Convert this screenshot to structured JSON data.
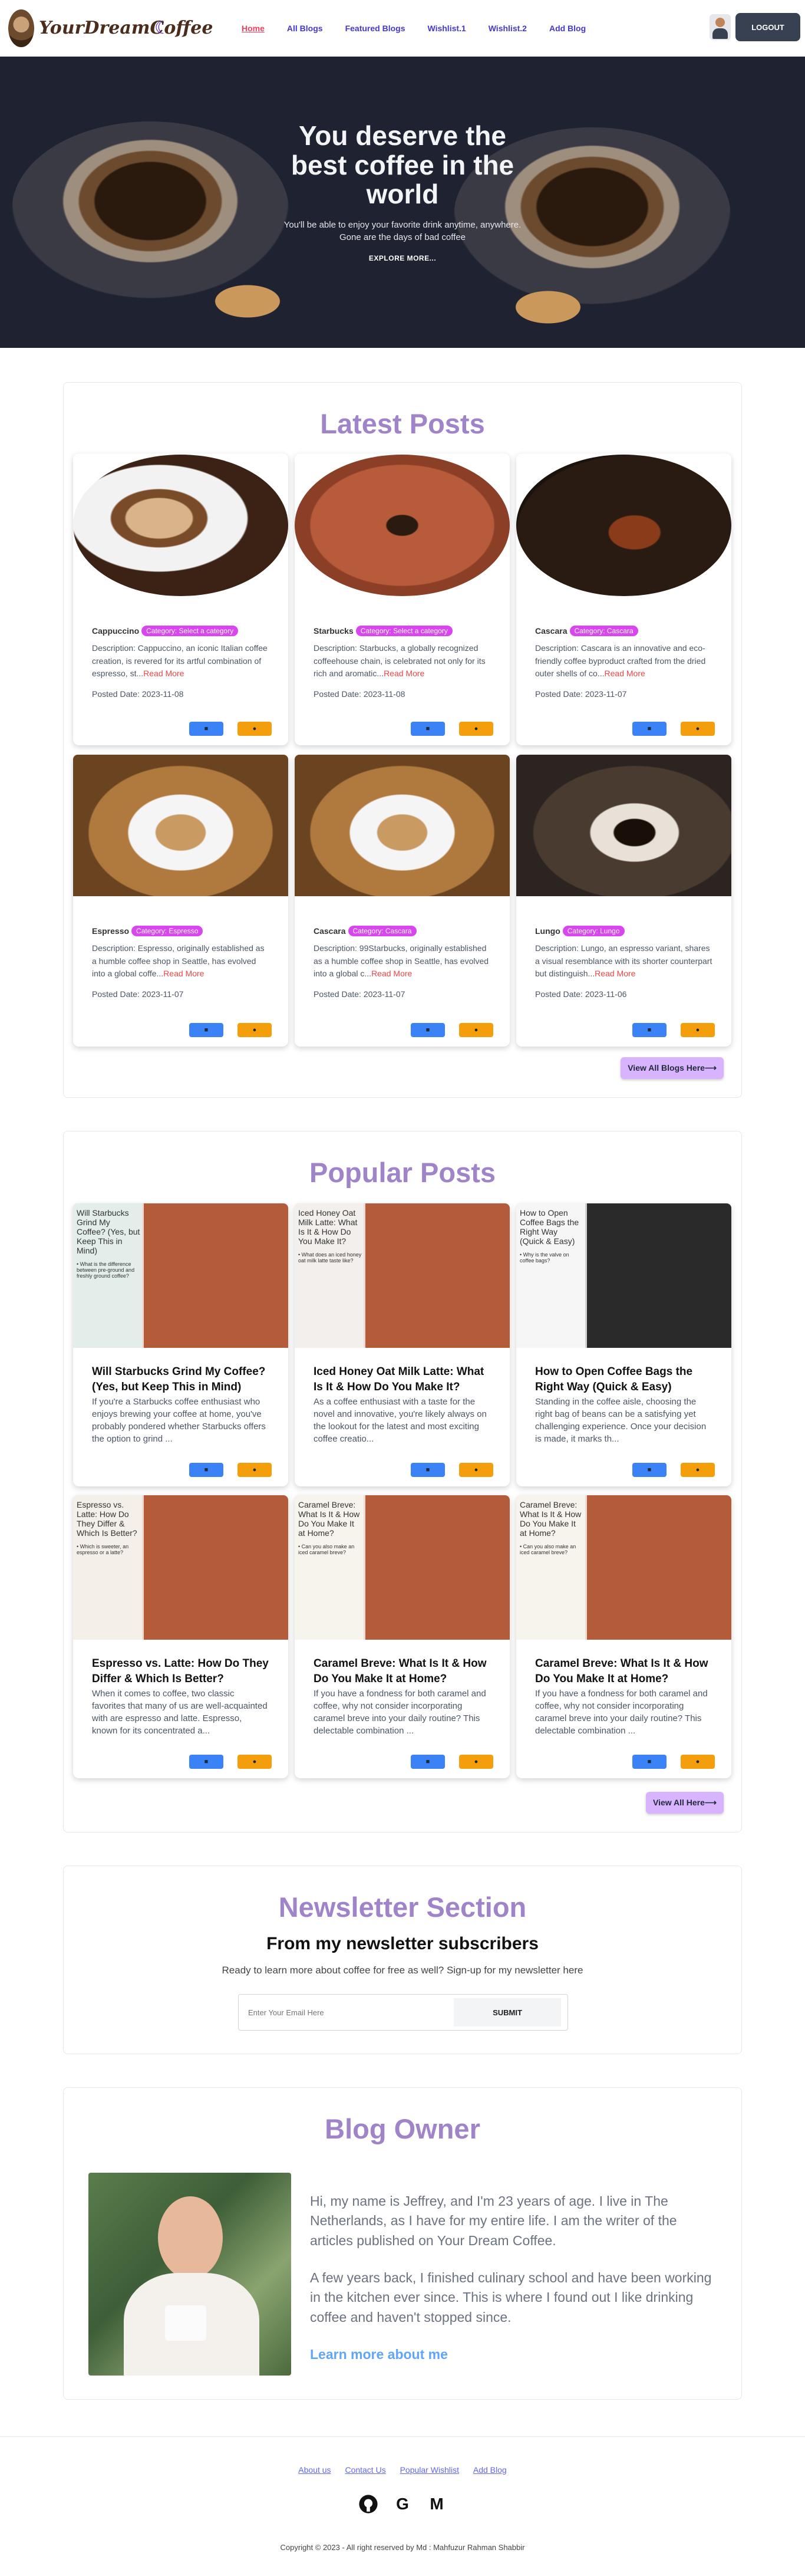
{
  "nav": {
    "logo_text": "YourDreamCoffee",
    "links": [
      "Home",
      "All Blogs",
      "Featured Blogs",
      "Wishlist.1",
      "Wishlist.2",
      "Add Blog"
    ],
    "logout": "LOGOUT"
  },
  "hero": {
    "title": "You deserve the best coffee in the world",
    "sub_line1": "You'll be able to enjoy your favorite drink anytime, anywhere.",
    "sub_line2": "Gone are the days of bad coffee",
    "button": "EXPLORE MORE..."
  },
  "latest": {
    "title": "Latest Posts",
    "view_all": "View All Blogs Here⟶",
    "posts": [
      {
        "name": "Cappuccino",
        "category": "Category: Select a category",
        "desc": "Description: Cappuccino, an iconic Italian coffee creation, is revered for its artful combination of espresso, st...",
        "more": "Read More",
        "date": "Posted Date: 2023-11-08"
      },
      {
        "name": "Starbucks",
        "category": "Category: Select a category",
        "desc": "Description: Starbucks, a globally recognized coffeehouse chain, is celebrated not only for its rich and aromatic...",
        "more": "Read More",
        "date": "Posted Date: 2023-11-08"
      },
      {
        "name": "Cascara",
        "category": "Category: Cascara",
        "desc": "Description: Cascara is an innovative and eco-friendly coffee byproduct crafted from the dried outer shells of co...",
        "more": "Read More",
        "date": "Posted Date: 2023-11-07"
      },
      {
        "name": "Espresso",
        "category": "Category: Espresso",
        "desc": "Description: Espresso, originally established as a humble coffee shop in Seattle, has evolved into a global coffe...",
        "more": "Read More",
        "date": "Posted Date: 2023-11-07"
      },
      {
        "name": "Cascara",
        "category": "Category: Cascara",
        "desc": "Description: 99Starbucks, originally established as a humble coffee shop in Seattle, has evolved into a global c...",
        "more": "Read More",
        "date": "Posted Date: 2023-11-07"
      },
      {
        "name": "Lungo",
        "category": "Category: Lungo",
        "desc": "Description: Lungo, an espresso variant, shares a visual resemblance with its shorter counterpart but distinguish...",
        "more": "Read More",
        "date": "Posted Date: 2023-11-06"
      }
    ]
  },
  "popular": {
    "title": "Popular Posts",
    "view_all": "View All Here⟶",
    "posts": [
      {
        "img_title": "Will Starbucks Grind My Coffee? (Yes, but Keep This in Mind)",
        "img_q": "• What is the difference between pre-ground and freshly ground coffee?",
        "title": "Will Starbucks Grind My Coffee? (Yes, but Keep This in Mind)",
        "desc": "If you're a Starbucks coffee enthusiast who enjoys brewing your coffee at home, you've probably pondered whether Starbucks offers the option to grind ..."
      },
      {
        "img_title": "Iced Honey Oat Milk Latte: What Is It & How Do You Make It?",
        "img_q": "• What does an iced honey oat milk latte taste like?",
        "title": "Iced Honey Oat Milk Latte: What Is It & How Do You Make It?",
        "desc": "As a coffee enthusiast with a taste for the novel and innovative, you're likely always on the lookout for the latest and most exciting coffee creatio..."
      },
      {
        "img_title": "How to Open Coffee Bags the Right Way (Quick & Easy)",
        "img_q": "• Why is the valve on coffee bags?",
        "title": "How to Open Coffee Bags the Right Way (Quick & Easy)",
        "desc": "Standing in the coffee aisle, choosing the right bag of beans can be a satisfying yet challenging experience. Once your decision is made, it marks th..."
      },
      {
        "img_title": "Espresso vs. Latte: How Do They Differ & Which Is Better?",
        "img_q": "• Which is sweeter, an espresso or a latte?",
        "title": "Espresso vs. Latte: How Do They Differ & Which Is Better?",
        "desc": "When it comes to coffee, two classic favorites that many of us are well-acquainted with are espresso and latte. Espresso, known for its concentrated a..."
      },
      {
        "img_title": "Caramel Breve: What Is It & How Do You Make It at Home?",
        "img_q": "• Can you also make an iced caramel breve?",
        "title": "Caramel Breve: What Is It & How Do You Make It at Home?",
        "desc": "If you have a fondness for both caramel and coffee, why not consider incorporating caramel breve into your daily routine? This delectable combination ..."
      },
      {
        "img_title": "Caramel Breve: What Is It & How Do You Make It at Home?",
        "img_q": "• Can you also make an iced caramel breve?",
        "title": "Caramel Breve: What Is It & How Do You Make It at Home?",
        "desc": "If you have a fondness for both caramel and coffee, why not consider incorporating caramel breve into your daily routine? This delectable combination ..."
      }
    ]
  },
  "newsletter": {
    "title": "Newsletter Section",
    "subtitle": "From my newsletter subscribers",
    "text": "Ready to learn more about coffee for free as well? Sign-up for my newsletter here",
    "placeholder": "Enter Your Email Here",
    "button": "SUBMIT"
  },
  "owner": {
    "title": "Blog Owner",
    "p1": "Hi, my name is Jeffrey, and I'm 23 years of age. I live in The Netherlands, as I have for my entire life. I am the writer of the articles published on Your Dream Coffee.",
    "p2": "A few years back, I finished culinary school and have been working in the kitchen ever since. This is where I found out I like drinking coffee and haven't stopped since.",
    "link": "Learn more about me"
  },
  "footer": {
    "links": [
      "About us",
      "Contact Us",
      "Popular Wishlist",
      "Add Blog"
    ],
    "social_icons": [
      "github-icon",
      "google-icon",
      "gmail-icon"
    ],
    "copyright": "Copyright © 2023 - All right reserved by Md : Mahfuzur Rahman Shabbir"
  },
  "colors": {
    "section_title": "#a084ca",
    "badge": "#d946ef",
    "read_more": "#ef4444",
    "bookmark_btn": "#3b82f6",
    "view_btn": "#f59e0b",
    "view_all_btn": "#d8b4fe"
  }
}
